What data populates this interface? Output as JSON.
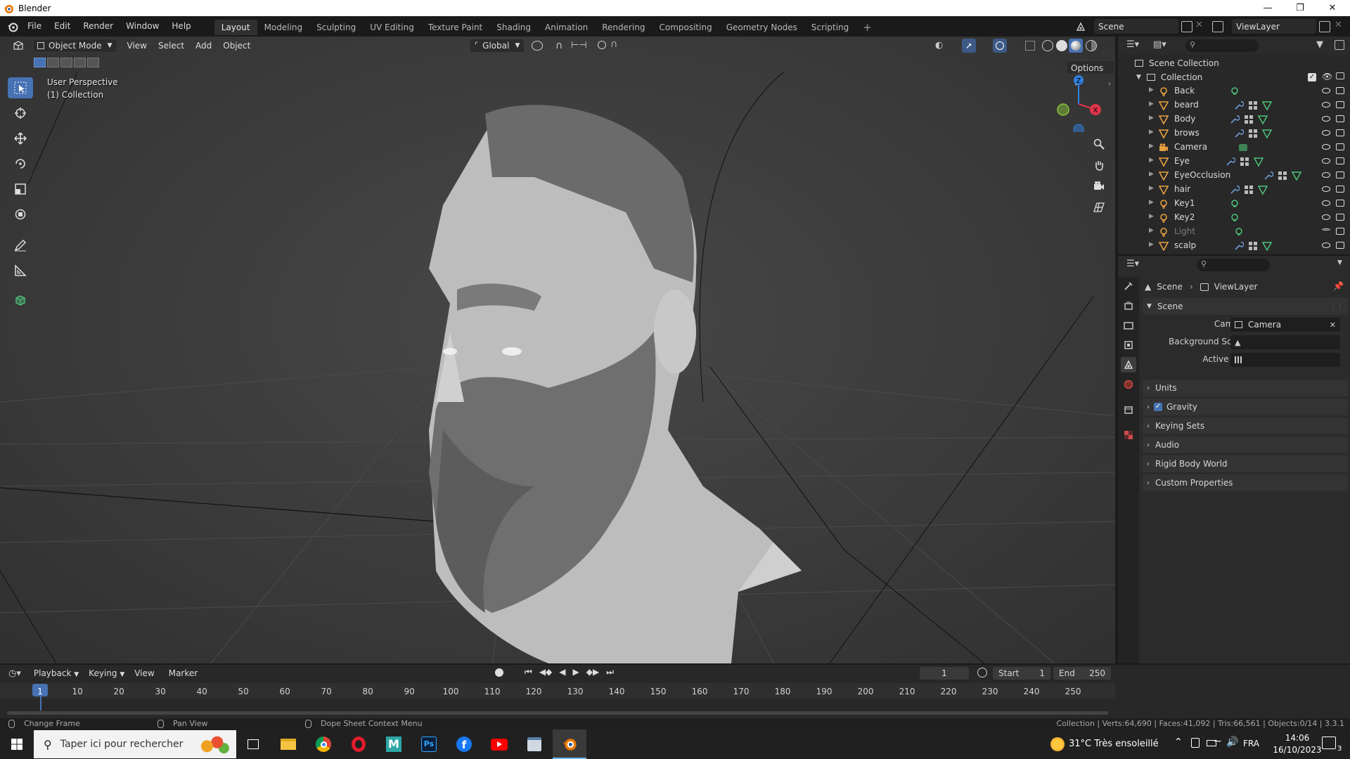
{
  "window": {
    "title": "Blender"
  },
  "menubar": {
    "menus": [
      "File",
      "Edit",
      "Render",
      "Window",
      "Help"
    ],
    "workspaces": [
      "Layout",
      "Modeling",
      "Sculpting",
      "UV Editing",
      "Texture Paint",
      "Shading",
      "Animation",
      "Rendering",
      "Compositing",
      "Geometry Nodes",
      "Scripting"
    ],
    "active_workspace": "Layout",
    "scene": "Scene",
    "view_layer": "ViewLayer"
  },
  "viewport": {
    "mode": "Object Mode",
    "menus": [
      "View",
      "Select",
      "Add",
      "Object"
    ],
    "orientation": "Global",
    "options_label": "Options",
    "perspective_label": "User Perspective",
    "collection_label": "(1) Collection",
    "gizmo": {
      "x": "X",
      "z": "Z"
    }
  },
  "outliner": {
    "root": "Scene Collection",
    "collection": "Collection",
    "items": [
      {
        "name": "Back",
        "type": "light",
        "dim": false
      },
      {
        "name": "beard",
        "type": "mesh",
        "dim": false
      },
      {
        "name": "Body",
        "type": "mesh",
        "dim": false
      },
      {
        "name": "brows",
        "type": "mesh",
        "dim": false
      },
      {
        "name": "Camera",
        "type": "camera",
        "dim": false
      },
      {
        "name": "Eye",
        "type": "mesh",
        "dim": false
      },
      {
        "name": "EyeOcclusion",
        "type": "mesh",
        "dim": false
      },
      {
        "name": "hair",
        "type": "mesh",
        "dim": false
      },
      {
        "name": "Key1",
        "type": "light",
        "dim": false
      },
      {
        "name": "Key2",
        "type": "light",
        "dim": false
      },
      {
        "name": "Light",
        "type": "light",
        "dim": true
      },
      {
        "name": "scalp",
        "type": "mesh",
        "dim": false
      }
    ]
  },
  "properties": {
    "breadcrumb": {
      "scene": "Scene",
      "view_layer": "ViewLayer"
    },
    "scene_panel": {
      "title": "Scene",
      "camera_label": "Camera",
      "camera_value": "Camera",
      "background_scene_label": "Background Scene",
      "active_clip_label": "Active Clip"
    },
    "panels": [
      "Units",
      "Gravity",
      "Keying Sets",
      "Audio",
      "Rigid Body World",
      "Custom Properties"
    ]
  },
  "timeline": {
    "menus": [
      "Playback",
      "Keying",
      "View",
      "Marker"
    ],
    "current_frame": "1",
    "start_label": "Start",
    "start": "1",
    "end_label": "End",
    "end": "250",
    "ruler": [
      "1",
      "10",
      "20",
      "30",
      "40",
      "50",
      "60",
      "70",
      "80",
      "90",
      "100",
      "110",
      "120",
      "130",
      "140",
      "150",
      "160",
      "170",
      "180",
      "190",
      "200",
      "210",
      "220",
      "230",
      "240",
      "250"
    ]
  },
  "statusbar": {
    "hint1": "Change Frame",
    "hint2": "Pan View",
    "hint3": "Dope Sheet Context Menu",
    "stats": "Collection | Verts:64,690 | Faces:41,092 | Tris:66,561 | Objects:0/14 | 3.3.1"
  },
  "taskbar": {
    "search_placeholder": "Taper ici pour rechercher",
    "weather": "31°C  Très ensoleillé",
    "lang": "FRA",
    "time": "14:06",
    "date": "16/10/2023",
    "notification_count": "3"
  },
  "colors": {
    "accent": "#4772b3",
    "axis_x": "#e0354a",
    "axis_y": "#8ac33a",
    "axis_z": "#2f7fe0",
    "mesh_icon": "#e8a040",
    "modifier_icon": "#6c9bd6",
    "data_icon": "#4ec27a"
  }
}
